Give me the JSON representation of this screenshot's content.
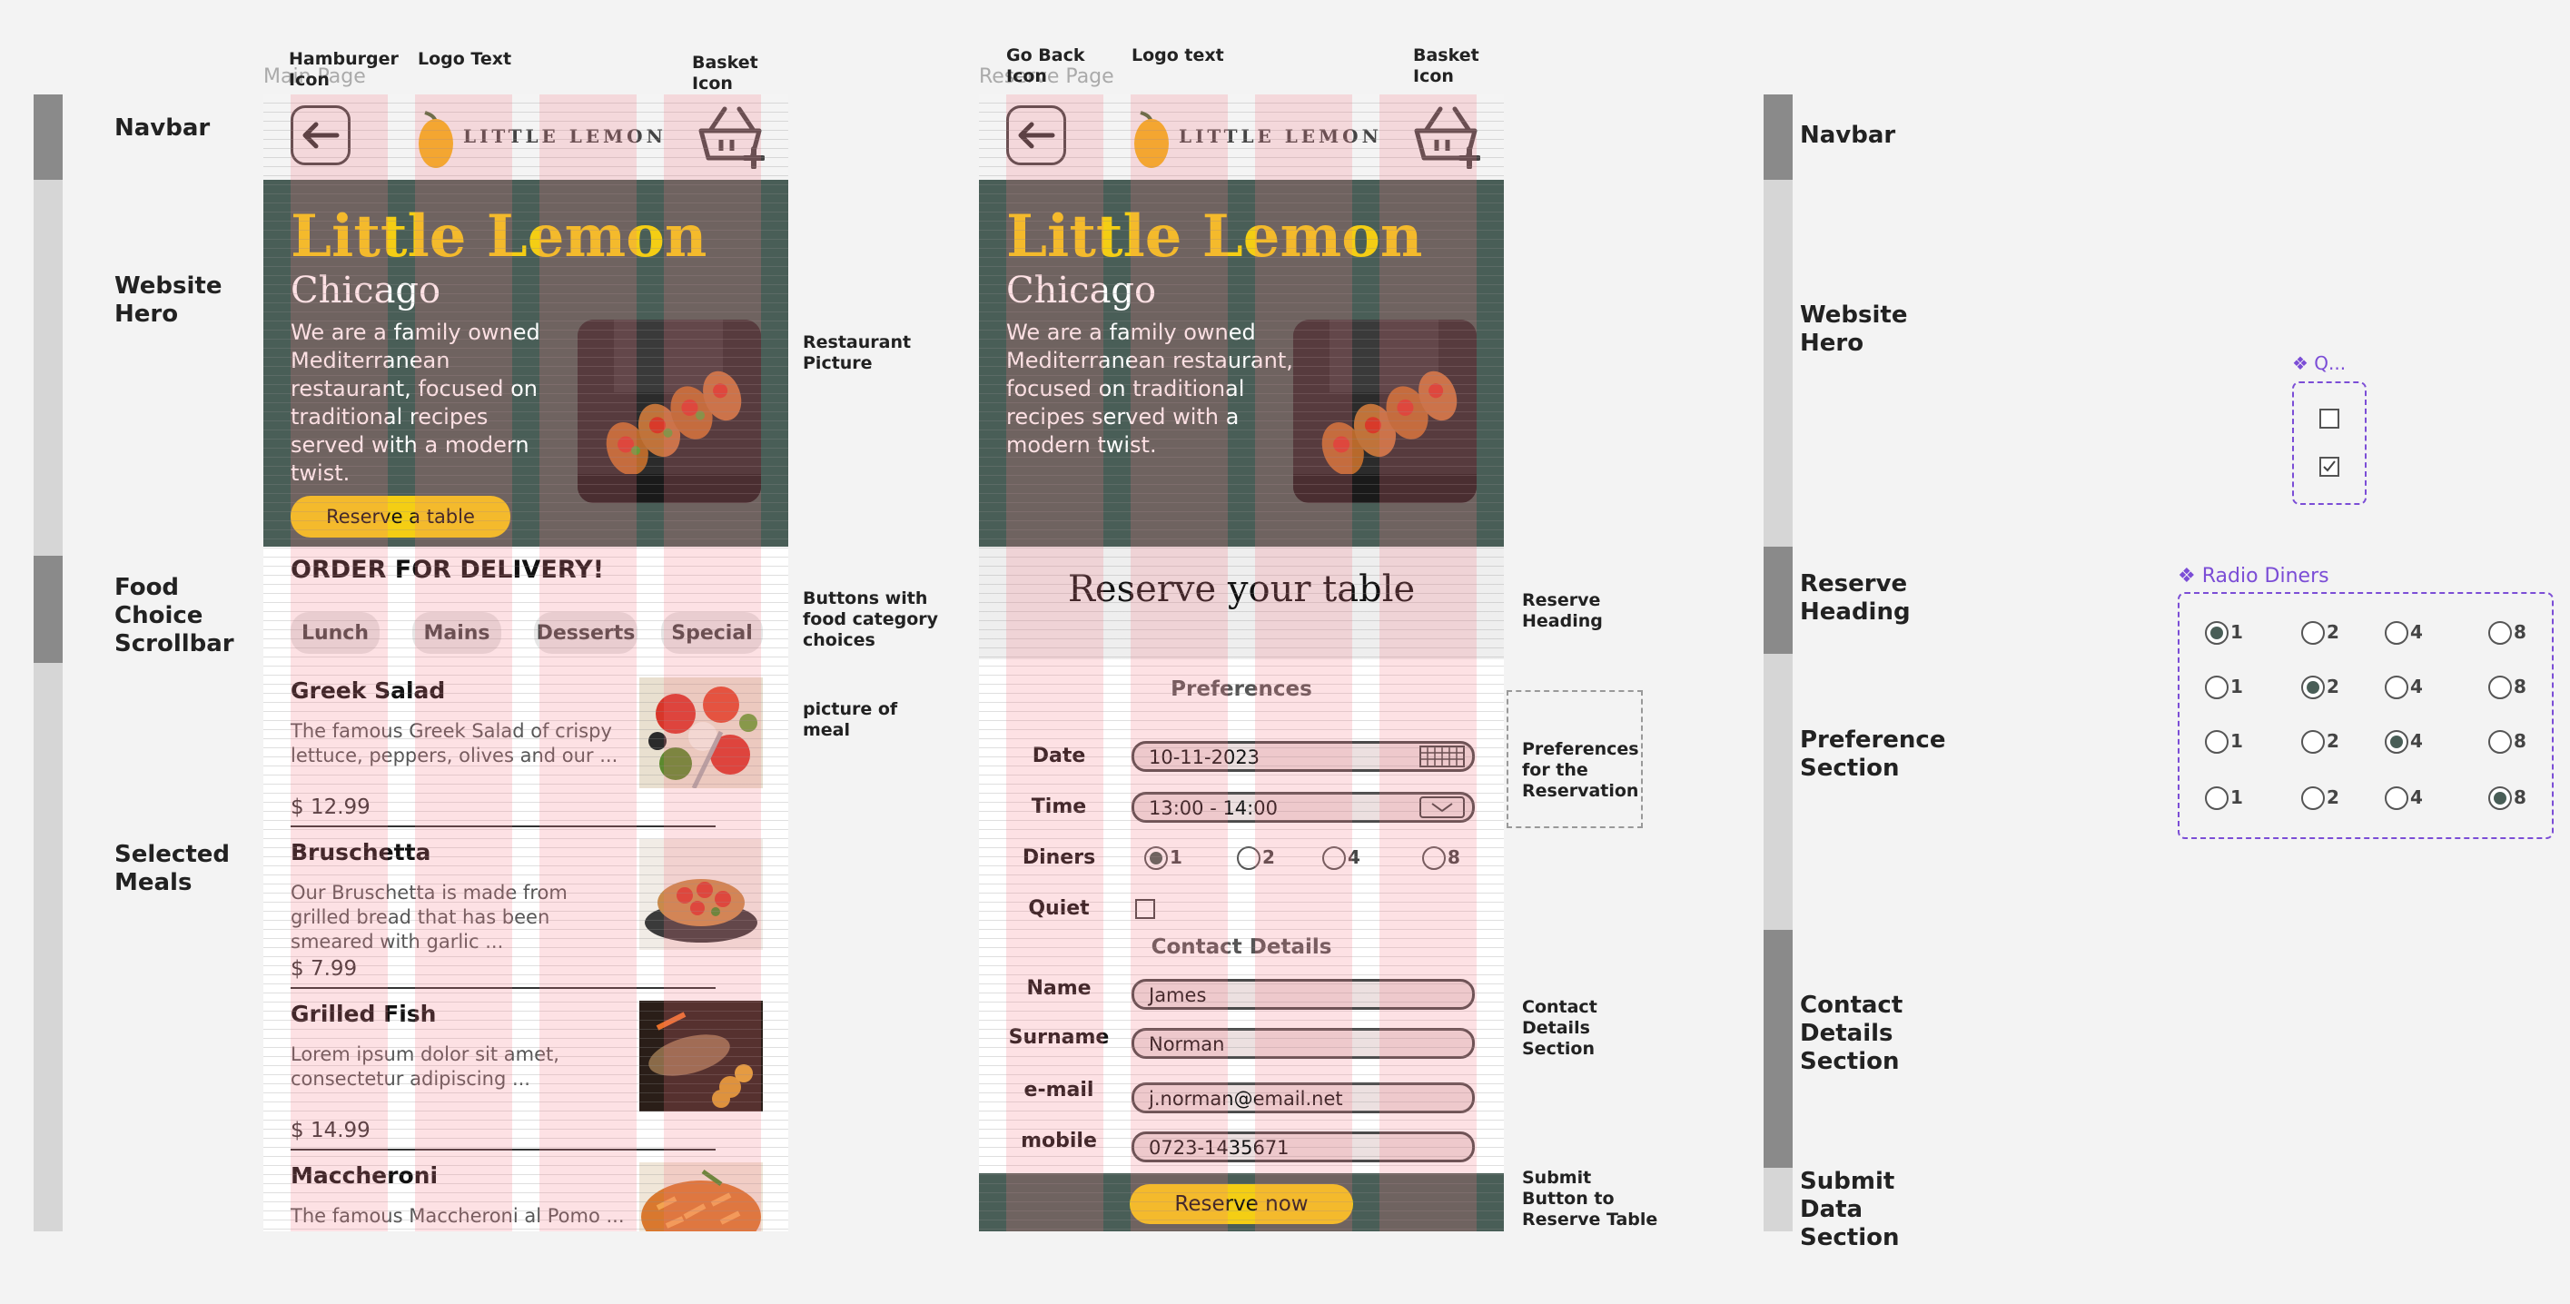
{
  "colors": {
    "primary_green": "#495e57",
    "primary_yellow": "#f4ce14",
    "component_purple": "#7b4dd6"
  },
  "left_bars": [
    {
      "label": "Navbar"
    },
    {
      "label": "Website Hero"
    },
    {
      "label": "Food Choice Scrollbar"
    },
    {
      "label": "Selected Meals"
    }
  ],
  "right_bars": [
    {
      "label": "Navbar"
    },
    {
      "label": "Website Hero"
    },
    {
      "label": "Reserve Heading"
    },
    {
      "label": "Preference Section"
    },
    {
      "label": "Contact Details Section"
    },
    {
      "label": "Submit Data Section"
    }
  ],
  "frame_titles": {
    "main": "Main Page",
    "reserve": "Reserve Page"
  },
  "annotations": {
    "hamburger": "Hamburger Icon",
    "logo_text_main": "Logo Text",
    "basket_main": "Basket Icon",
    "go_back": "Go Back Icon",
    "logo_text_reserve": "Logo text",
    "basket_reserve": "Basket Icon",
    "restaurant_picture": "Restaurant Picture",
    "buttons_food": "Buttons with food category choices",
    "picture_meal": "picture of meal",
    "reserve_heading": "Reserve Heading",
    "preferences": "Preferences for the Reservation",
    "contact_details": "Contact Details Section",
    "submit_button": "Submit Button to Reserve Table"
  },
  "brand": {
    "logo": "LITTLE LEMON",
    "title": "Little Lemon",
    "city": "Chicago",
    "description": "We are a family owned Mediterranean restaurant, focused on traditional recipes served with a modern twist."
  },
  "main_page": {
    "reserve_button": "Reserve a table",
    "order_heading": "ORDER FOR DELIVERY!",
    "categories": [
      "Lunch",
      "Mains",
      "Desserts",
      "Special"
    ],
    "meals": [
      {
        "name": "Greek Salad",
        "desc": "The famous Greek Salad of crispy lettuce, peppers, olives and our ...",
        "price": "$ 12.99"
      },
      {
        "name": "Bruschetta",
        "desc": "Our Bruschetta is made from grilled bread that has been smeared with garlic ...",
        "price": "$ 7.99"
      },
      {
        "name": "Grilled Fish",
        "desc": "Lorem ipsum dolor sit amet, consectetur adipiscing ...",
        "price": "$ 14.99"
      },
      {
        "name": "Maccheroni",
        "desc": "The famous Maccheroni al Pomo ...",
        "price": ""
      }
    ]
  },
  "reserve_page": {
    "heading": "Reserve your table",
    "preferences_title": "Preferences",
    "date_label": "Date",
    "date_value": "10-11-2023",
    "time_label": "Time",
    "time_value": "13:00 - 14:00",
    "diners_label": "Diners",
    "diners_options": [
      "1",
      "2",
      "4",
      "8"
    ],
    "diners_selected": "1",
    "quiet_label": "Quiet",
    "contact_title": "Contact Details",
    "name_label": "Name",
    "name_value": "James",
    "surname_label": "Surname",
    "surname_value": "Norman",
    "email_label": "e-mail",
    "email_value": "j.norman@email.net",
    "mobile_label": "mobile",
    "mobile_value": "0723-1435671",
    "submit_button": "Reserve now"
  },
  "components": {
    "checkbox_title": "Q...",
    "radio_title": "Radio Diners",
    "radio_options": [
      "1",
      "2",
      "4",
      "8"
    ],
    "radio_rows_selected": [
      "1",
      "2",
      "4",
      "8"
    ]
  }
}
